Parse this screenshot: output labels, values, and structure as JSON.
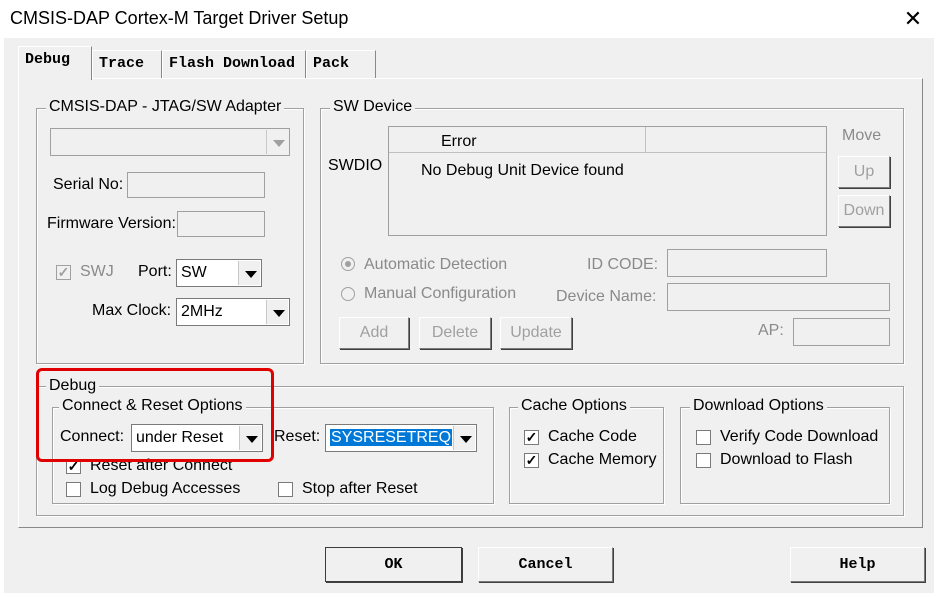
{
  "window": {
    "title": "CMSIS-DAP Cortex-M Target Driver Setup"
  },
  "tabs": [
    {
      "label": "Debug",
      "active": true
    },
    {
      "label": "Trace",
      "active": false
    },
    {
      "label": "Flash Download",
      "active": false
    },
    {
      "label": "Pack",
      "active": false
    }
  ],
  "adapter": {
    "title": "CMSIS-DAP - JTAG/SW Adapter",
    "serial_label": "Serial No:",
    "serial_value": "",
    "firmware_label": "Firmware Version:",
    "firmware_value": "",
    "swj_label": "SWJ",
    "swj_checked": true,
    "port_label": "Port:",
    "port_value": "SW",
    "maxclock_label": "Max Clock:",
    "maxclock_value": "2MHz"
  },
  "sw_device": {
    "title": "SW Device",
    "swdio_label": "SWDIO",
    "column_header": "Error",
    "row_message": "No Debug Unit Device found",
    "move_label": "Move",
    "up_label": "Up",
    "down_label": "Down",
    "auto_detect_label": "Automatic Detection",
    "manual_config_label": "Manual Configuration",
    "id_code_label": "ID CODE:",
    "device_name_label": "Device Name:",
    "ap_label": "AP:",
    "add_label": "Add",
    "delete_label": "Delete",
    "update_label": "Update"
  },
  "debug": {
    "title": "Debug",
    "connect_reset_title": "Connect & Reset Options",
    "connect_label": "Connect:",
    "connect_value": "under Reset",
    "reset_label": "Reset:",
    "reset_value": "SYSRESETREQ",
    "reset_after_connect_label": "Reset after Connect",
    "reset_after_connect_checked": true,
    "log_debug_label": "Log Debug Accesses",
    "stop_after_reset_label": "Stop after Reset",
    "cache_title": "Cache Options",
    "cache_code_label": "Cache Code",
    "cache_memory_label": "Cache Memory",
    "download_title": "Download Options",
    "verify_label": "Verify Code Download",
    "download_flash_label": "Download to Flash"
  },
  "footer": {
    "ok_label": "OK",
    "cancel_label": "Cancel",
    "help_label": "Help"
  },
  "colors": {
    "highlight_box": "#e00000",
    "selection": "#0078d7"
  }
}
